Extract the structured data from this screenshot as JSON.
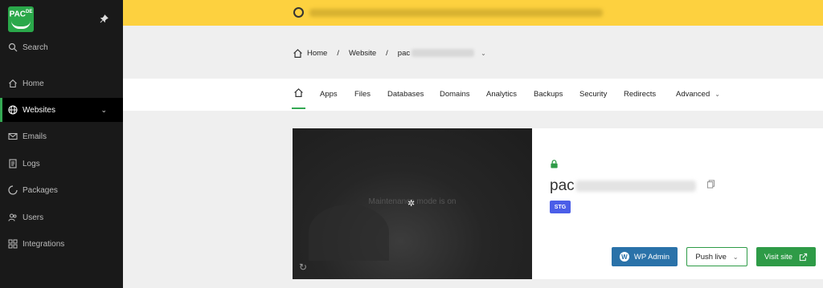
{
  "sidebar": {
    "logo": {
      "text": "PAC",
      "sup": "DE"
    },
    "search_label": "Search",
    "items": [
      {
        "label": "Home",
        "icon": "home-icon"
      },
      {
        "label": "Websites",
        "icon": "globe-icon",
        "active": true
      },
      {
        "label": "Emails",
        "icon": "mail-icon"
      },
      {
        "label": "Logs",
        "icon": "logs-icon"
      },
      {
        "label": "Packages",
        "icon": "package-icon"
      },
      {
        "label": "Users",
        "icon": "users-icon"
      },
      {
        "label": "Integrations",
        "icon": "integrations-icon"
      }
    ]
  },
  "banner": {
    "icon": "notice-icon",
    "accent": "#fdd13f"
  },
  "breadcrumb": {
    "home": "Home",
    "website": "Website",
    "site_prefix": "pac"
  },
  "tabs": [
    "Apps",
    "Files",
    "Databases",
    "Domains",
    "Analytics",
    "Backups",
    "Security",
    "Redirects",
    "Advanced"
  ],
  "site": {
    "name_prefix": "pac",
    "env_badge": "STG",
    "preview_message": "Maintenance mode is on",
    "buttons": {
      "wp_admin": "WP Admin",
      "push_live": "Push live",
      "visit_site": "Visit site"
    }
  },
  "colors": {
    "sidebar_bg": "#191919",
    "brand_green": "#34a853",
    "wp_blue": "#2a72a9",
    "badge_blue": "#4b5ee8"
  }
}
